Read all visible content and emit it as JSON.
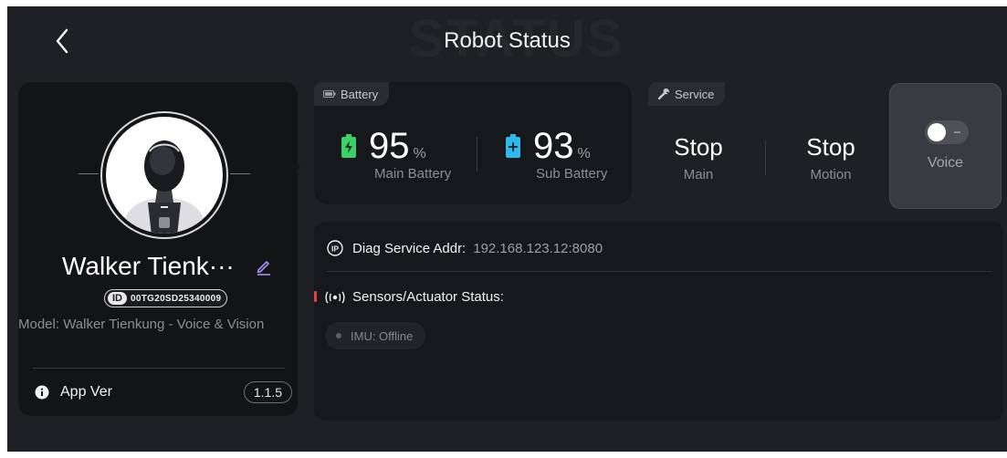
{
  "header": {
    "title": "Robot Status",
    "watermark": "STATUS"
  },
  "profile": {
    "name": "Walker Tienk···",
    "id_tag": "ID",
    "id_value": "00TG20SD25340009",
    "model": "Model:  Walker Tienkung - Voice & Vision",
    "app_ver_label": "App Ver",
    "app_ver_value": "1.1.5"
  },
  "battery": {
    "tab_label": "Battery",
    "main": {
      "value": "95",
      "unit": "%",
      "label": "Main Battery"
    },
    "sub": {
      "value": "93",
      "unit": "%",
      "label": "Sub Battery"
    }
  },
  "service": {
    "tab_label": "Service",
    "main": {
      "value": "Stop",
      "label": "Main"
    },
    "motion": {
      "value": "Stop",
      "label": "Motion"
    }
  },
  "voice": {
    "label": "Voice",
    "enabled": false
  },
  "diag": {
    "addr_label": "Diag Service Addr:",
    "addr_value": "192.168.123.12:8080",
    "sensors_label": "Sensors/Actuator Status:",
    "imu_status": "IMU: Offline"
  },
  "colors": {
    "background": "#1f2023",
    "card": "#17181b",
    "battery_main_accent": "#3ecf6a",
    "battery_sub_accent": "#2fb8e8",
    "alert_red": "#e0424a"
  },
  "icons": {
    "back": "chevron-left-icon",
    "edit": "pencil-icon",
    "info": "info-icon",
    "battery_tab": "battery-icon",
    "service_tab": "wrench-icon",
    "main_battery": "battery-charging-icon",
    "sub_battery": "battery-plus-icon",
    "diag": "ip-icon",
    "sensors": "broadcast-icon"
  }
}
